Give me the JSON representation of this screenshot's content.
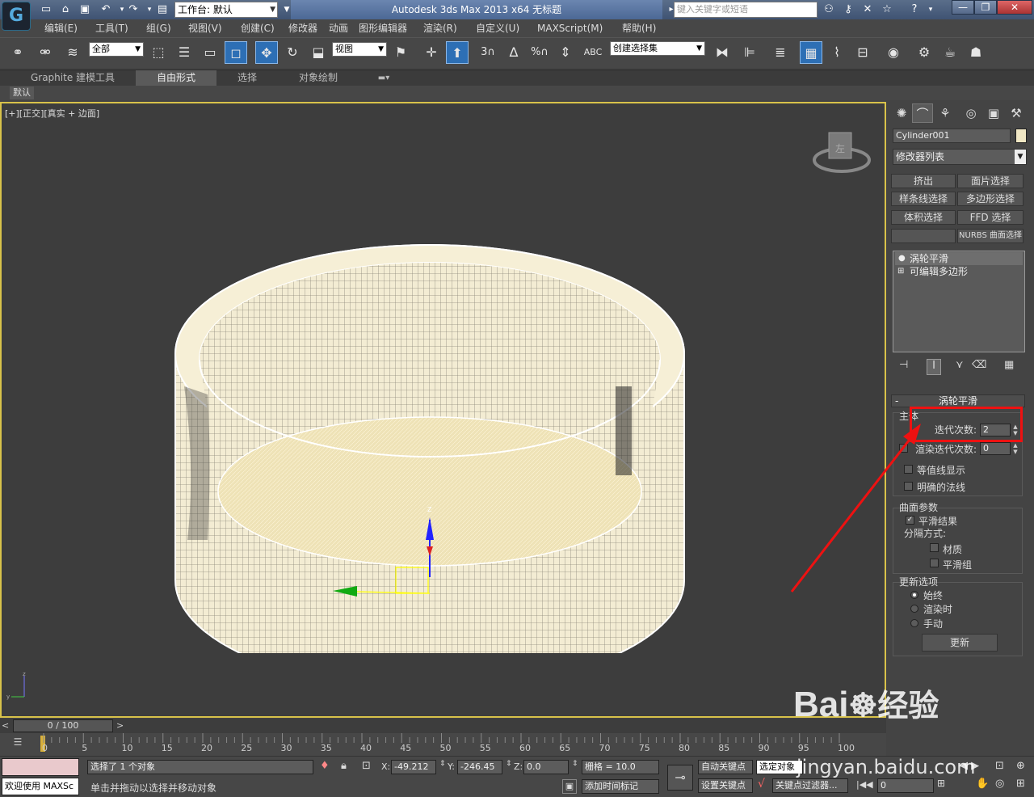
{
  "titlebar": {
    "workspace_label": "工作台: 默认",
    "app_title": "Autodesk 3ds Max  2013 x64      无标题",
    "search_placeholder": "键入关键字或短语"
  },
  "menu": [
    "编辑(E)",
    "工具(T)",
    "组(G)",
    "视图(V)",
    "创建(C)",
    "修改器",
    "动画",
    "图形编辑器",
    "渲染(R)",
    "自定义(U)",
    "MAXScript(M)",
    "帮助(H)"
  ],
  "toolbar": {
    "selection_filter": "全部",
    "ref_coord": "视图",
    "named_selection": "创建选择集"
  },
  "ribbon": {
    "tabs": [
      "Graphite 建模工具",
      "自由形式",
      "选择",
      "对象绘制"
    ],
    "active_tab": "自由形式",
    "subtab": "默认"
  },
  "viewport": {
    "label": "[+][正交][真实 + 边面]"
  },
  "command_panel": {
    "object_name": "Cylinder001",
    "modifier_list": "修改器列表",
    "buttons": [
      "挤出",
      "面片选择",
      "样条线选择",
      "多边形选择",
      "体积选择",
      "FFD 选择",
      "",
      "NURBS 曲面选择"
    ],
    "stack": [
      "涡轮平滑",
      "可编辑多边形"
    ],
    "rollout_title": "涡轮平滑",
    "main_group": "主体",
    "iterations_label": "迭代次数:",
    "iterations_value": "2",
    "render_iters_label": "渲染迭代次数:",
    "render_iters_value": "0",
    "isoline_display": "等值线显示",
    "explicit_normals": "明确的法线",
    "surface_group": "曲面参数",
    "smooth_result": "平滑结果",
    "separate_by": "分隔方式:",
    "materials": "材质",
    "smoothing_groups": "平滑组",
    "update_group": "更新选项",
    "always": "始终",
    "when_rendering": "渲染时",
    "manually": "手动",
    "update_btn": "更新"
  },
  "timeline": {
    "frame": "0 / 100",
    "ticks": [
      "0",
      "5",
      "10",
      "15",
      "20",
      "25",
      "30",
      "35",
      "40",
      "45",
      "50",
      "55",
      "60",
      "65",
      "70",
      "75",
      "80",
      "85",
      "90",
      "95",
      "100"
    ]
  },
  "status": {
    "welcome": "欢迎使用 MAXSc",
    "selected": "选择了 1 个对象",
    "prompt": "单击并拖动以选择并移动对象",
    "x_label": "X:",
    "x": "-49.212",
    "y_label": "Y:",
    "y": "-246.45",
    "z_label": "Z:",
    "z": "0.0",
    "grid": "栅格 = 10.0",
    "add_time_tag": "添加时间标记",
    "auto_key": "自动关键点",
    "selected_obj": "选定对象",
    "set_key": "设置关键点",
    "key_filters": "关键点过滤器...",
    "frame_field": "0"
  },
  "watermark": {
    "brand": "Bai",
    "brand2": "经验",
    "url": "jingyan.baidu.com"
  }
}
